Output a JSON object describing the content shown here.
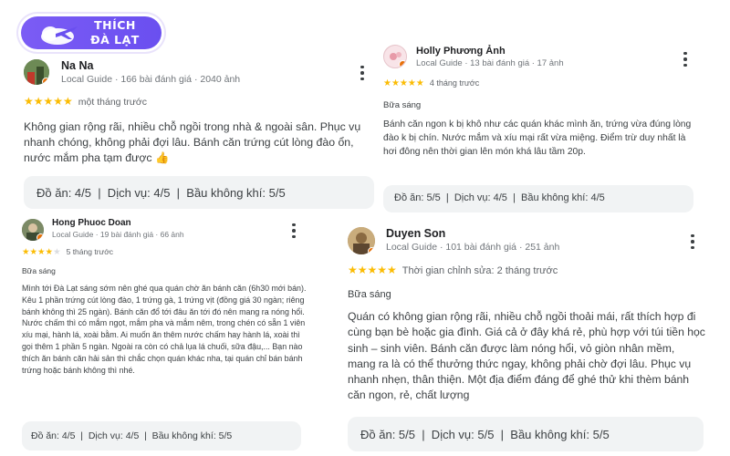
{
  "logo": {
    "line1": "THÍCH",
    "line2": "ĐÀ LẠT"
  },
  "reviews": [
    {
      "name": "Na Na",
      "meta": "Local Guide · 166 bài đánh giá · 2040 ảnh",
      "stars": 5,
      "time": "một tháng trước",
      "meal": "",
      "text": "Không gian rộng rãi, nhiều chỗ ngồi trong nhà & ngoài sân. Phục vụ nhanh chóng, không phải đợi lâu. Bánh căn trứng cút lòng đào ổn, nước mắm pha tạm được 👍",
      "ratings": "Đồ ăn: 4/5  |  Dịch vụ: 4/5  |  Bầu không khí: 5/5"
    },
    {
      "name": "Holly Phương Ảnh",
      "meta": "Local Guide · 13 bài đánh giá · 17 ảnh",
      "stars": 5,
      "time": "4 tháng trước",
      "meal": "Bữa sáng",
      "text": "Bánh căn ngon k bị khô như các quán khác mình ăn, trứng vừa đúng lòng đào k bị chín. Nước mắm và xíu mại rất vừa miệng. Điểm trừ duy nhất là hơi đông nên thời gian lên món khá lâu tầm 20p.",
      "ratings": "Đồ ăn: 5/5  |  Dịch vụ: 4/5  |  Bầu không khí: 4/5"
    },
    {
      "name": "Hong Phuoc Doan",
      "meta": "Local Guide · 19 bài đánh giá · 66 ảnh",
      "stars": 4,
      "time": "5 tháng trước",
      "meal": "Bữa sáng",
      "text": "Mình tới Đà Lạt sáng sớm nên ghé qua quán chờ ăn bánh căn (6h30 mới bán). Kêu 1 phần trứng cút lòng đào, 1 trứng gà, 1 trứng vịt (đồng giá 30 ngàn; riêng bánh không thì 25 ngàn). Bánh căn đổ tới đâu ăn tới đó nên mang ra nóng hổi. Nước chấm thì có mắm ngọt, mắm pha và mắm nêm, trong chén có sẵn 1 viên xíu mại, hành lá, xoài bằm. Ai muốn ăn thêm nước chấm hay hành lá, xoài thì gọi thêm 1 phần 5 ngàn. Ngoài ra còn có chả lụa lá chuối, sữa đậu,... Bạn nào thích ăn bánh căn hải sản thì chắc chọn quán khác nha, tại quán chỉ bán bánh trứng hoặc bánh không thì nhé.",
      "ratings": "Đồ ăn: 4/5  |  Dịch vụ: 4/5  |  Bầu không khí: 5/5"
    },
    {
      "name": "Duyen Son",
      "meta": "Local Guide · 101 bài đánh giá · 251 ảnh",
      "stars": 5,
      "time": "Thời gian chỉnh sửa: 2 tháng trước",
      "meal": "Bữa sáng",
      "text": "Quán có không gian rộng rãi, nhiều chỗ ngồi thoải mái, rất thích hợp đi cùng bạn bè hoặc gia đình. Giá cả ở đây khá rẻ, phù hợp với túi tiền học sinh – sinh viên. Bánh căn được làm nóng hổi, vỏ giòn nhân mềm, mang ra là có thể thưởng thức ngay, không phải chờ đợi lâu. Phục vụ nhanh nhẹn, thân thiện. Một địa điểm đáng để ghé thử khi thèm bánh căn ngon, rẻ, chất lượng",
      "ratings": "Đồ ăn: 5/5  |  Dịch vụ: 5/5  |  Bầu không khí: 5/5"
    }
  ],
  "colors": {
    "star": "#fbbc04",
    "guide_badge": "#e8710a",
    "logo_bg": "#6a4ff0"
  }
}
